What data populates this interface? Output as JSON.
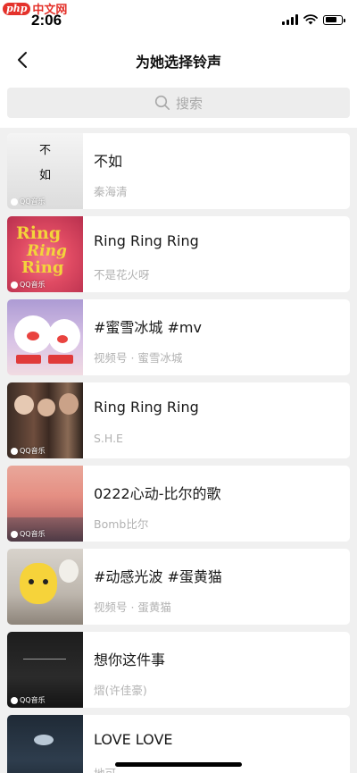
{
  "status_bar": {
    "watermark_logo": "php",
    "watermark_text": "中文网",
    "time": "2:06"
  },
  "nav": {
    "title": "为她选择铃声"
  },
  "search": {
    "placeholder": "搜索"
  },
  "thumb_label": "QQ音乐",
  "cover_art": {
    "c1": {
      "line1": "不",
      "line2": "如"
    },
    "c2": {
      "line1": "Ring",
      "line2": "Ring",
      "line3": "Ring"
    }
  },
  "songs": [
    {
      "title": "不如",
      "subtitle": "秦海清"
    },
    {
      "title": "Ring Ring Ring",
      "subtitle": "不是花火呀"
    },
    {
      "title": "#蜜雪冰城 #mv",
      "subtitle": "视频号 · 蜜雪冰城"
    },
    {
      "title": "Ring Ring Ring",
      "subtitle": "S.H.E"
    },
    {
      "title": "0222心动-比尔的歌",
      "subtitle": "Bomb比尔"
    },
    {
      "title": "#动感光波 #蛋黄猫",
      "subtitle": "视频号 · 蛋黄猫"
    },
    {
      "title": "想你这件事",
      "subtitle": "熠(许佳豪)"
    },
    {
      "title": "LOVE LOVE",
      "subtitle": "地可"
    }
  ],
  "colors": {
    "accent_text": "#191919",
    "subtitle": "#b2b2b2",
    "background": "#f0f0f0"
  }
}
